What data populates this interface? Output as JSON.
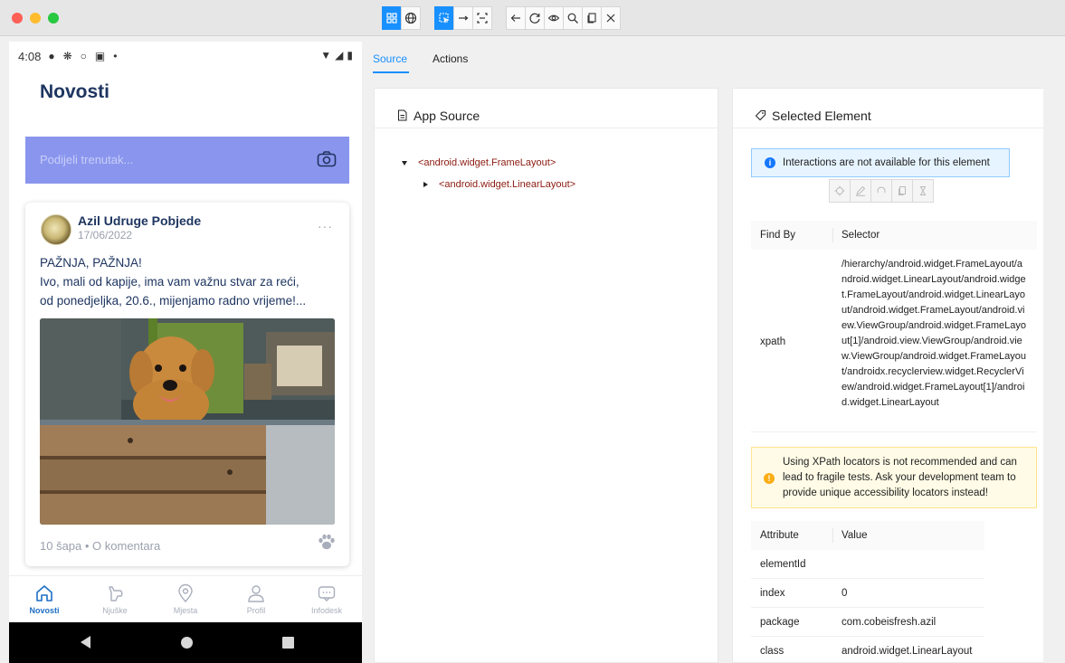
{
  "phone": {
    "status_time": "4:08",
    "app_title": "Novosti",
    "share_placeholder": "Podijeli trenutak...",
    "post": {
      "author": "Azil Udruge Pobjede",
      "date": "17/06/2022",
      "more": "···",
      "line1": "PAŽNJA, PAŽNJA!",
      "line2": "Ivo, mali od kapije, ima vam važnu stvar za reći,",
      "line3": "od ponedjeljka, 20.6., mijenjamo radno vrijeme!...",
      "footer": "10 šapa • O komentara"
    },
    "nav": [
      {
        "label": "Novosti"
      },
      {
        "label": "Njuške"
      },
      {
        "label": "Mjesta"
      },
      {
        "label": "Profil"
      },
      {
        "label": "Infodesk"
      }
    ]
  },
  "inspector": {
    "tabs": {
      "source": "Source",
      "actions": "Actions"
    },
    "app_source": {
      "title": "App Source",
      "nodes": [
        "<android.widget.FrameLayout>",
        "<android.widget.LinearLayout>"
      ]
    },
    "selected": {
      "title": "Selected Element",
      "info": "Interactions are not available for this element",
      "find_by_header": "Find By",
      "selector_header": "Selector",
      "xpath_key": "xpath",
      "xpath_value": "/hierarchy/android.widget.FrameLayout/android.widget.LinearLayout/android.widget.FrameLayout/android.widget.LinearLayout/android.widget.FrameLayout/android.view.ViewGroup/android.widget.FrameLayout[1]/android.view.ViewGroup/android.view.ViewGroup/android.widget.FrameLayout/androidx.recyclerview.widget.RecyclerView/android.widget.FrameLayout[1]/android.widget.LinearLayout",
      "warning": "Using XPath locators is not recommended and can lead to fragile tests. Ask your development team to provide unique accessibility locators instead!",
      "attr_header": "Attribute",
      "value_header": "Value",
      "attributes": [
        {
          "key": "elementId",
          "value": ""
        },
        {
          "key": "index",
          "value": "0"
        },
        {
          "key": "package",
          "value": "com.cobeisfresh.azil"
        },
        {
          "key": "class",
          "value": "android.widget.LinearLayout"
        }
      ]
    }
  },
  "colors": {
    "accent": "#1890ff",
    "app_navy": "#1e3560",
    "share_purple": "#8a96ee",
    "xml_tag": "#8b1a10"
  }
}
